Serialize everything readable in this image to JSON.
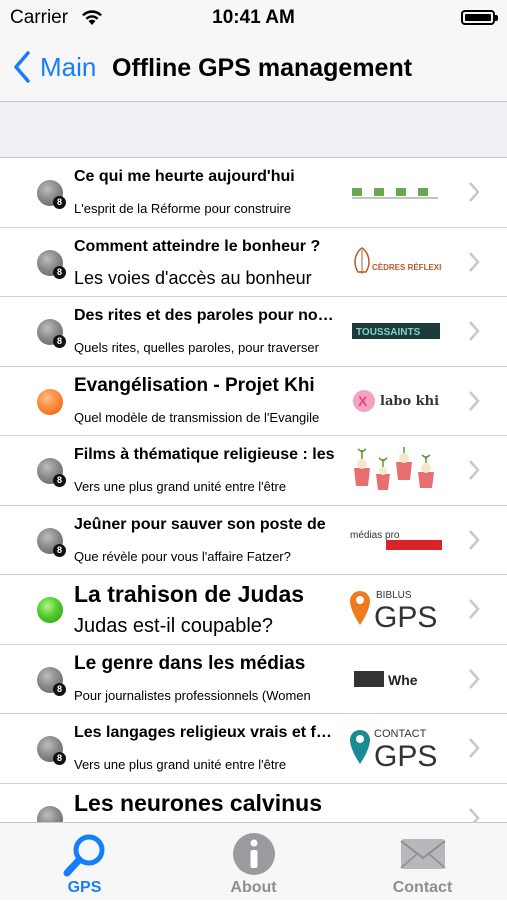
{
  "status_bar": {
    "carrier": "Carrier",
    "time": "10:41 AM"
  },
  "nav": {
    "back_label": "Main",
    "title": "Offline GPS management"
  },
  "rows": [
    {
      "title": "Ce qui me heurte aujourd'hui",
      "subtitle": "L'esprit de la Réforme pour construire",
      "status": "gray",
      "badge": "8",
      "logo_text": ""
    },
    {
      "title": "Comment atteindre le bonheur ?",
      "subtitle": "Les voies d'accès au bonheur",
      "status": "gray",
      "badge": "8",
      "logo_text": "CÈDRES RÉFLEXION"
    },
    {
      "title": "Des rites et des paroles pour nos vies",
      "subtitle": "Quels rites, quelles paroles, pour traverser",
      "status": "gray",
      "badge": "8",
      "logo_text": "TOUSSAINTS"
    },
    {
      "title": "Evangélisation - Projet Khi",
      "subtitle": "Quel modèle de transmission de l'Evangile",
      "status": "orange",
      "badge": "",
      "logo_text": "labo khi"
    },
    {
      "title": "Films à thématique religieuse : les",
      "subtitle": "Vers une plus grand unité entre l'être",
      "status": "gray",
      "badge": "8",
      "logo_text": ""
    },
    {
      "title": "Jeûner pour sauver son poste de",
      "subtitle": "Que révèle pour vous l'affaire Fatzer?",
      "status": "gray",
      "badge": "8",
      "logo_text": "médias pro"
    },
    {
      "title": "La trahison de Judas",
      "subtitle": "Judas est-il coupable?",
      "status": "green",
      "badge": "",
      "logo_text": "BIBLUS GPS"
    },
    {
      "title": "Le genre dans les médias",
      "subtitle": "Pour journalistes professionnels (Women",
      "status": "gray",
      "badge": "8",
      "logo_text": "Whe"
    },
    {
      "title": "Les langages religieux vrais et faux",
      "subtitle": "Vers une plus grand unité entre l'être",
      "status": "gray",
      "badge": "8",
      "logo_text": "CONTACT GPS"
    },
    {
      "title": "Les neurones calvinus",
      "subtitle": "",
      "status": "gray",
      "badge": "8",
      "logo_text": ""
    }
  ],
  "tabs": [
    {
      "label": "GPS",
      "icon": "search-icon",
      "active": true
    },
    {
      "label": "About",
      "icon": "info-icon",
      "active": false
    },
    {
      "label": "Contact",
      "icon": "mail-icon",
      "active": false
    }
  ],
  "colors": {
    "accent": "#157efb",
    "bar_bg": "#f7f7f7",
    "section_bg": "#efeff4",
    "separator": "#c8c8cc"
  }
}
